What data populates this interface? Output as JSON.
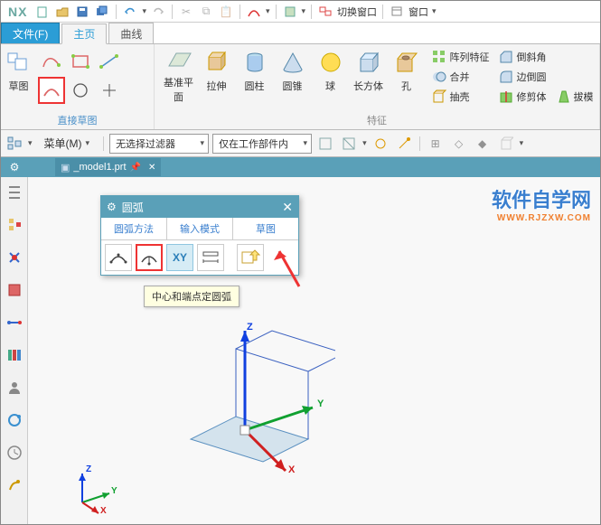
{
  "app_name": "NX",
  "titlebar": {
    "switch_window": "切换窗口",
    "window_menu": "窗口"
  },
  "tabs": {
    "file": "文件(F)",
    "home": "主页",
    "curve": "曲线"
  },
  "ribbon": {
    "sketch_group": "直接草图",
    "sketch_btn": "草图",
    "feature_group": "特征",
    "datum_plane": "基准平面",
    "extrude": "拉伸",
    "cylinder": "圆柱",
    "cone": "圆锥",
    "sphere": "球",
    "block": "长方体",
    "hole": "孔",
    "pattern_feature": "阵列特征",
    "unite": "合并",
    "shell": "抽壳",
    "chamfer": "倒斜角",
    "edge_blend": "边倒圆",
    "trim_body": "修剪体",
    "draft": "拔模"
  },
  "filterbar": {
    "menu": "菜单(M)",
    "no_filter": "无选择过滤器",
    "work_part_only": "仅在工作部件内"
  },
  "document": {
    "name": "_model1.prt"
  },
  "dialog": {
    "title": "圆弧",
    "tab_method": "圆弧方法",
    "tab_input": "输入模式",
    "tab_sketch": "草图",
    "xy_label": "XY"
  },
  "tooltip": "中心和端点定圆弧",
  "axes": {
    "x": "X",
    "y": "Y",
    "z": "Z"
  },
  "watermark": {
    "big": "软件自学网",
    "small": "WWW.RJZXW.COM"
  }
}
